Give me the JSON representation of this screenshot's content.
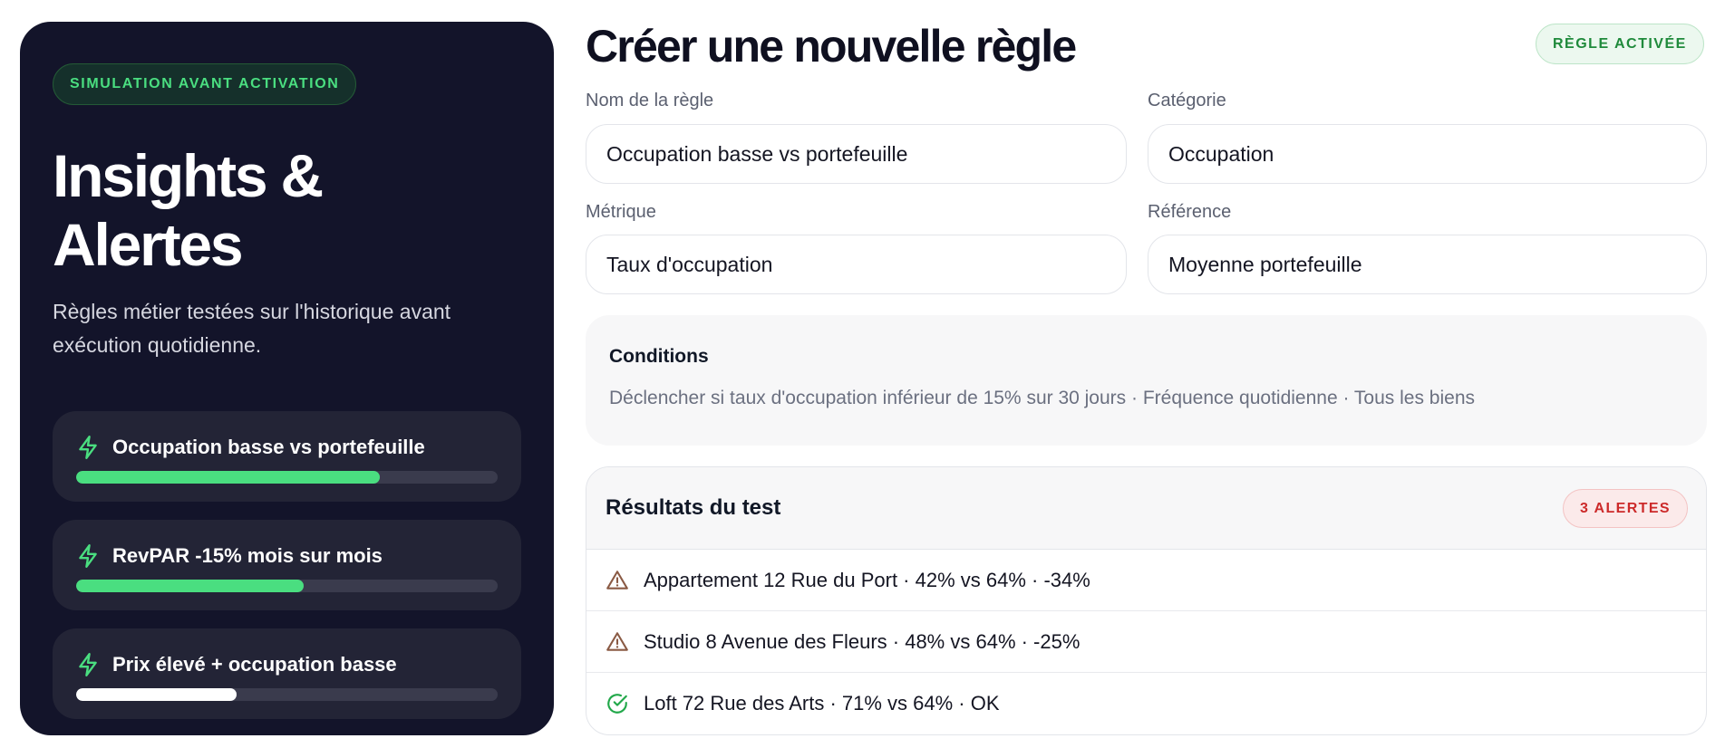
{
  "left_panel": {
    "badge": "SIMULATION AVANT ACTIVATION",
    "title": "Insights & Alertes",
    "description": "Règles métier testées sur l'historique avant exécution quotidienne.",
    "rules": [
      {
        "name": "Occupation basse vs portefeuille",
        "progress": 0.72,
        "color": "#4ade80",
        "icon": "bolt-icon"
      },
      {
        "name": "RevPAR -15% mois sur mois",
        "progress": 0.54,
        "color": "#4ade80",
        "icon": "bolt-icon"
      },
      {
        "name": "Prix élevé + occupation basse",
        "progress": 0.38,
        "color": "#ffffff",
        "icon": "bolt-icon"
      }
    ]
  },
  "form": {
    "title": "Créer une nouvelle règle",
    "status_badge": "RÈGLE ACTIVÉE",
    "fields": {
      "name": {
        "label": "Nom de la règle",
        "value": "Occupation basse vs portefeuille"
      },
      "category": {
        "label": "Catégorie",
        "value": "Occupation"
      },
      "metric": {
        "label": "Métrique",
        "value": "Taux d'occupation"
      },
      "reference": {
        "label": "Référence",
        "value": "Moyenne portefeuille"
      }
    },
    "conditions": {
      "title": "Conditions",
      "text": "Déclencher si taux d'occupation inférieur de 15% sur 30 jours · Fréquence quotidienne · Tous les biens"
    }
  },
  "results": {
    "title": "Résultats du test",
    "badge": "3 ALERTES",
    "rows": [
      {
        "text": "Appartement 12 Rue du Port · 42% vs 64% · -34%",
        "status": "warning",
        "icon": "warning-icon"
      },
      {
        "text": "Studio 8 Avenue des Fleurs · 48% vs 64% · -25%",
        "status": "warning",
        "icon": "warning-icon"
      },
      {
        "text": "Loft 72 Rue des Arts · 71% vs 64% · OK",
        "status": "ok",
        "icon": "check-circle-icon"
      }
    ]
  },
  "colors": {
    "panel_bg": "#13142a",
    "accent_green": "#4ade80",
    "warning_brown": "#8a5a44",
    "ok_green": "#22a84a",
    "alert_red": "#cc2a2a"
  }
}
